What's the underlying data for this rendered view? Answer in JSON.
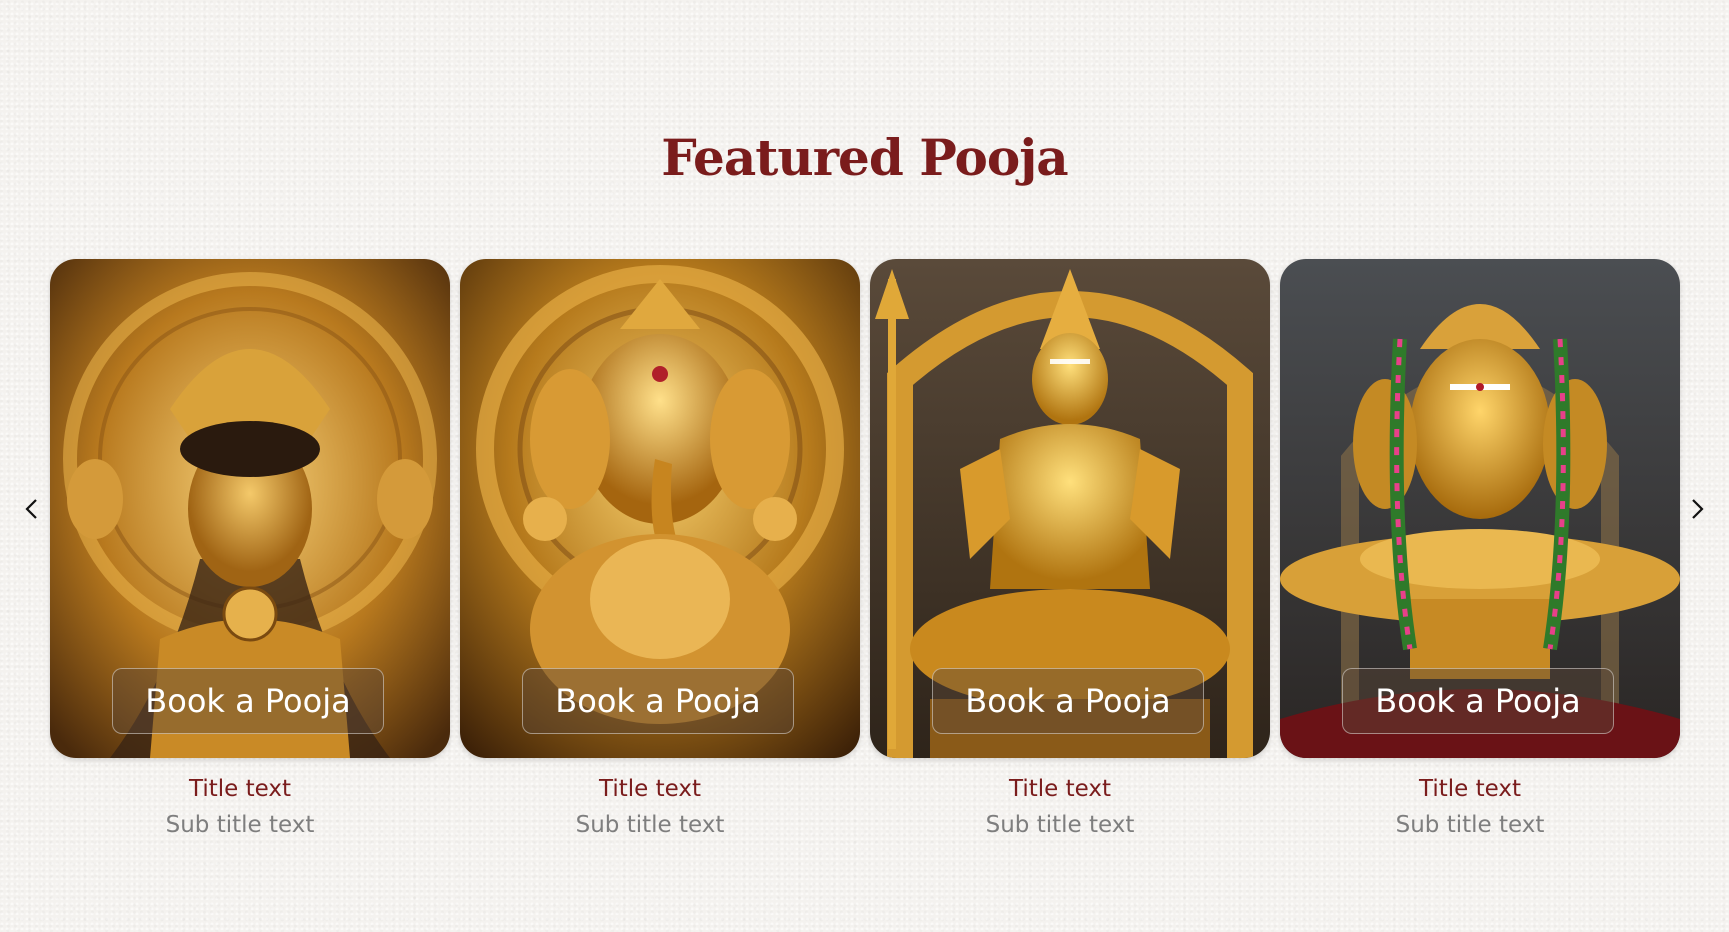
{
  "section": {
    "title": "Featured Pooja"
  },
  "carousel": {
    "prev_icon": "chevron-left-icon",
    "next_icon": "chevron-right-icon",
    "cards": [
      {
        "deity_image": "goddess-idol-image",
        "button_label": "Book a Pooja",
        "title": "Title text",
        "subtitle": "Sub title text"
      },
      {
        "deity_image": "ganesha-idol-image",
        "button_label": "Book a Pooja",
        "title": "Title text",
        "subtitle": "Sub title text"
      },
      {
        "deity_image": "shiva-idol-image",
        "button_label": "Book a Pooja",
        "title": "Title text",
        "subtitle": "Sub title text"
      },
      {
        "deity_image": "shiva-lingam-mukha-image",
        "button_label": "Book a Pooja",
        "title": "Title text",
        "subtitle": "Sub title text"
      }
    ]
  },
  "colors": {
    "title": "#7a1c1c",
    "subtitle": "#7e7e7e",
    "background": "#f4f2ef",
    "gold": "#c8901e"
  }
}
